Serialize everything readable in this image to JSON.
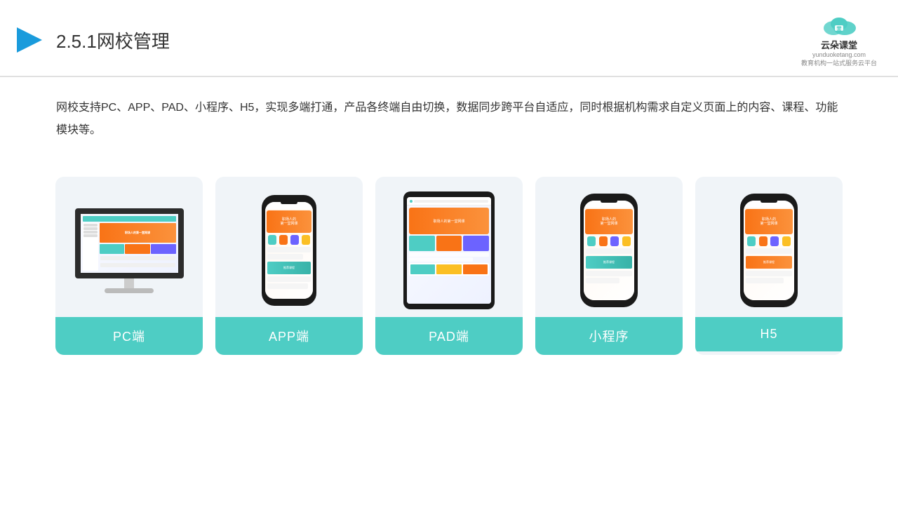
{
  "header": {
    "title_number": "2.5.1",
    "title_main": "网校管理",
    "logo_name": "云朵课堂",
    "logo_url": "yunduoketang.com",
    "logo_tagline": "教育机构一站式服务云平台"
  },
  "description": {
    "text": "网校支持PC、APP、PAD、小程序、H5，实现多端打通，产品各终端自由切换，数据同步跨平台自适应，同时根据机构需求自定义页面上的内容、课程、功能模块等。"
  },
  "cards": [
    {
      "id": "pc",
      "label": "PC端"
    },
    {
      "id": "app",
      "label": "APP端"
    },
    {
      "id": "pad",
      "label": "PAD端"
    },
    {
      "id": "miniprogram",
      "label": "小程序"
    },
    {
      "id": "h5",
      "label": "H5"
    }
  ],
  "colors": {
    "teal": "#4ecdc4",
    "orange": "#f97316",
    "dark": "#1a1a1a",
    "bg_card": "#f0f4f8",
    "accent_blue": "#4a90d9"
  }
}
